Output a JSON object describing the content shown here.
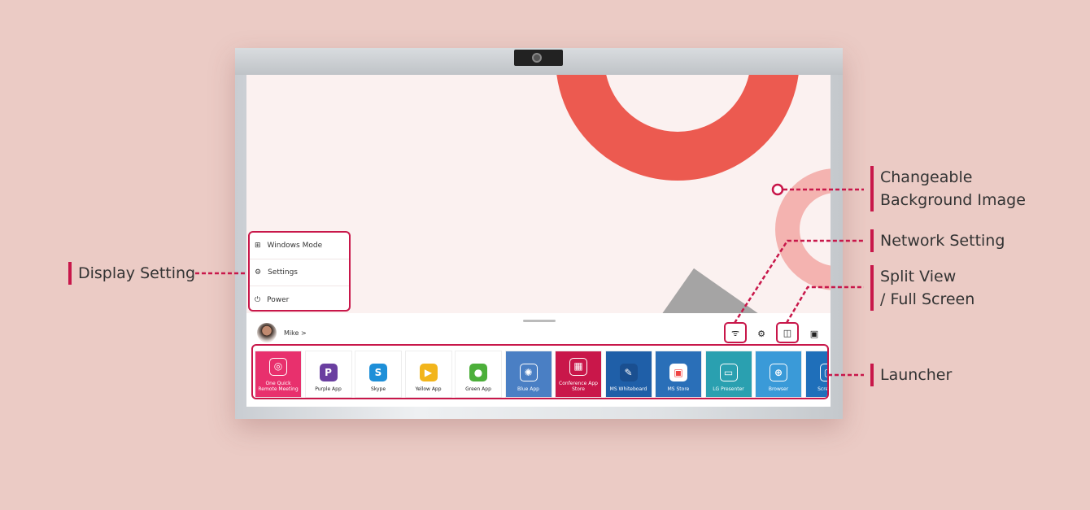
{
  "menu": {
    "items": [
      {
        "label": "Windows Mode",
        "icon": "windows-grid-icon"
      },
      {
        "label": "Settings",
        "icon": "gear-icon"
      },
      {
        "label": "Power",
        "icon": "power-icon"
      }
    ]
  },
  "user": {
    "name": "Mike >"
  },
  "toolbar": {
    "icons": [
      "wifi-icon",
      "settings-gear-icon",
      "split-view-icon",
      "screen-share-icon"
    ]
  },
  "launcher": {
    "apps": [
      {
        "label": "One Quick Remote Meeting",
        "color": "#e8306d",
        "text": "#ffffff",
        "icon_color": "#e8306d",
        "glyph": "◎"
      },
      {
        "label": "Purple App",
        "color": "#ffffff",
        "text": "#222222",
        "icon_color": "#6a3fa0",
        "glyph": "P"
      },
      {
        "label": "Skype",
        "color": "#ffffff",
        "text": "#222222",
        "icon_color": "#1e8fd8",
        "glyph": "S"
      },
      {
        "label": "Yellow App",
        "color": "#ffffff",
        "text": "#222222",
        "icon_color": "#f2b51c",
        "glyph": "▶"
      },
      {
        "label": "Green App",
        "color": "#ffffff",
        "text": "#222222",
        "icon_color": "#4caf3a",
        "glyph": "●"
      },
      {
        "label": "Blue App",
        "color": "#4a7fc4",
        "text": "#ffffff",
        "icon_color": "#4a7fc4",
        "glyph": "✺"
      },
      {
        "label": "Conference App Store",
        "color": "#c9174a",
        "text": "#ffffff",
        "icon_color": "#c9174a",
        "glyph": "▦"
      },
      {
        "label": "MS Whiteboard",
        "color": "#1f5fa8",
        "text": "#ffffff",
        "icon_color": "#1a4f90",
        "glyph": "✎"
      },
      {
        "label": "MS Store",
        "color": "#2a6fb8",
        "text": "#ffffff",
        "icon_color": "#ffffff",
        "glyph": "▣"
      },
      {
        "label": "LG Presenter",
        "color": "#2aa0b0",
        "text": "#ffffff",
        "icon_color": "#2aa0b0",
        "glyph": "▭"
      },
      {
        "label": "Browser",
        "color": "#3a9ad8",
        "text": "#ffffff",
        "icon_color": "#3a9ad8",
        "glyph": "⊕"
      },
      {
        "label": "Screen C",
        "color": "#1f6fba",
        "text": "#ffffff",
        "icon_color": "#1f6fba",
        "glyph": "▢"
      }
    ]
  },
  "annotations": {
    "display_setting": "Display Setting",
    "background_line1": "Changeable",
    "background_line2": "Background Image",
    "network": "Network Setting",
    "split_line1": "Split View",
    "split_line2": "/ Full Screen",
    "launcher": "Launcher"
  },
  "colors": {
    "accent": "#c8174a",
    "page_bg": "#ebcbc5"
  }
}
